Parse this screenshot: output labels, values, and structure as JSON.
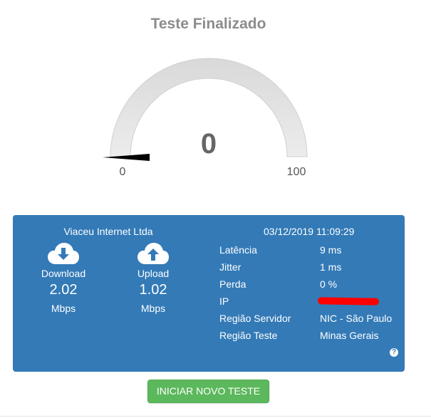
{
  "header": {
    "title": "Teste Finalizado"
  },
  "gauge": {
    "value": "0",
    "min_label": "0",
    "max_label": "100",
    "fraction": 0
  },
  "results": {
    "provider": "Viaceu Internet Ltda",
    "datetime": "03/12/2019 11:09:29",
    "download": {
      "label": "Download",
      "value": "2.02",
      "unit": "Mbps",
      "icon": "cloud-download-icon"
    },
    "upload": {
      "label": "Upload",
      "value": "1.02",
      "unit": "Mbps",
      "icon": "cloud-upload-icon"
    },
    "stats": [
      {
        "label": "Latência",
        "value": "9 ms"
      },
      {
        "label": "Jitter",
        "value": "1 ms"
      },
      {
        "label": "Perda",
        "value": "0 %"
      },
      {
        "label": "IP",
        "value": ""
      },
      {
        "label": "Região Servidor",
        "value": "NIC - São Paulo"
      },
      {
        "label": "Região Teste",
        "value": "Minas Gerais"
      }
    ],
    "help_icon": "?"
  },
  "actions": {
    "restart_label": "INICIAR NOVO TESTE"
  },
  "colors": {
    "panel": "#337ab7",
    "button": "#5cb85c",
    "gauge_track": "#e6e6e6",
    "redaction": "#ff0000"
  }
}
